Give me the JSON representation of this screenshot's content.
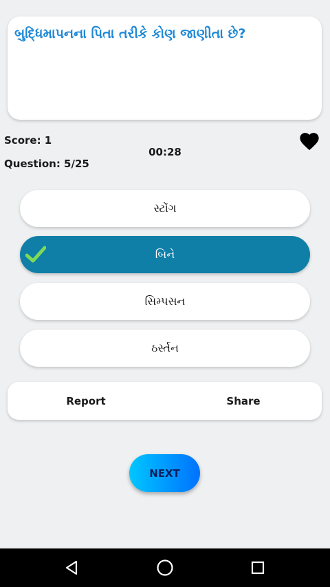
{
  "question": {
    "text": "બુદ્ધિમાપનના પિતા તરીકે કોણ જાણીતા છે?"
  },
  "status": {
    "score": "Score: 1",
    "question_counter": "Question: 5/25",
    "timer": "00:28"
  },
  "options": [
    {
      "label": "સ્ટોંગ",
      "selected": false
    },
    {
      "label": "બિને",
      "selected": true
    },
    {
      "label": "સિમ્પસન",
      "selected": false
    },
    {
      "label": "ઠર્સ્તન",
      "selected": false
    }
  ],
  "actions": {
    "report_label": "Report",
    "share_label": "Share"
  },
  "next_label": "NEXT",
  "icons": {
    "favorite": "heart-icon",
    "correct": "check-icon",
    "nav_back": "back-triangle-icon",
    "nav_home": "home-circle-icon",
    "nav_recents": "recents-square-icon"
  },
  "colors": {
    "question_text": "#1e88d6",
    "selected_option": "#0f7fa8",
    "check": "#7ed957",
    "next_gradient_start": "#00c6ff",
    "next_gradient_end": "#0072ff"
  }
}
